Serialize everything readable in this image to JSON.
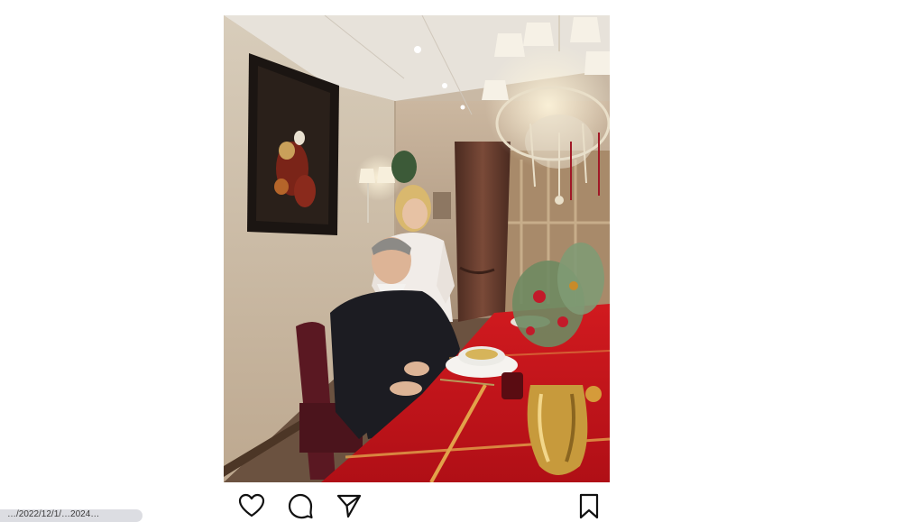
{
  "post": {
    "photo": {
      "alt_subject": "",
      "colors": {
        "wall": "#d9ccb8",
        "tablecloth": "#c9141a",
        "chair": "#5a1822",
        "curtain": "#5c3a2c",
        "frame": "#1b1512",
        "sweater": "#1c1c22",
        "blouse": "#f1ece8"
      }
    },
    "actions": [
      {
        "name": "like",
        "icon": "heart-icon"
      },
      {
        "name": "comment",
        "icon": "comment-bubble-icon"
      },
      {
        "name": "share",
        "icon": "send-paper-plane-icon"
      },
      {
        "name": "save",
        "icon": "bookmark-icon"
      }
    ]
  },
  "status_bar": {
    "url_text": "…/2022/12/1/…2024…"
  }
}
